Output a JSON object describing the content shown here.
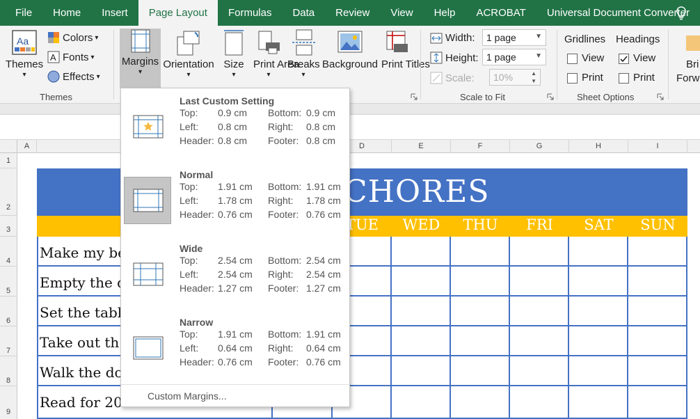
{
  "tabs": [
    {
      "label": "File"
    },
    {
      "label": "Home"
    },
    {
      "label": "Insert"
    },
    {
      "label": "Page Layout",
      "active": true
    },
    {
      "label": "Formulas"
    },
    {
      "label": "Data"
    },
    {
      "label": "Review"
    },
    {
      "label": "View"
    },
    {
      "label": "Help"
    },
    {
      "label": "ACROBAT"
    },
    {
      "label": "Universal Document Converter"
    }
  ],
  "ribbon": {
    "themes": {
      "themes_label": "Themes",
      "colors_label": "Colors",
      "fonts_label": "Fonts",
      "effects_label": "Effects",
      "group_label": "Themes"
    },
    "page_setup": {
      "margins_label": "Margins",
      "orientation_label": "Orientation",
      "size_label": "Size",
      "print_area_label": "Print Area",
      "breaks_label": "Breaks",
      "background_label": "Background",
      "print_titles_label": "Print Titles"
    },
    "scale": {
      "width_label": "Width:",
      "width_value": "1 page",
      "height_label": "Height:",
      "height_value": "1 page",
      "scale_label": "Scale:",
      "scale_value": "10%",
      "group_label": "Scale to Fit"
    },
    "sheet_options": {
      "gridlines_label": "Gridlines",
      "headings_label": "Headings",
      "view_label": "View",
      "print_label": "Print",
      "group_label": "Sheet Options",
      "gridlines_view": false,
      "gridlines_print": false,
      "headings_view": true,
      "headings_print": false
    },
    "arrange": {
      "bring_forward_label_1": "Bri",
      "bring_forward_label_2": "Forwa"
    }
  },
  "columns": [
    "A",
    "D",
    "E",
    "F",
    "G",
    "H",
    "I"
  ],
  "rows": [
    "1",
    "2",
    "3",
    "4",
    "5",
    "6",
    "7",
    "8",
    "9"
  ],
  "sheet": {
    "title": "CHORES",
    "days": [
      "TUE",
      "WED",
      "THU",
      "FRI",
      "SAT",
      "SUN"
    ],
    "chores": [
      "Make my be",
      "Empty the d",
      "Set the tabl",
      "Take out th",
      "Walk the do",
      "Read for 20"
    ]
  },
  "margins_menu": {
    "options": [
      {
        "name": "Last Custom Setting",
        "top_label": "Top:",
        "top": "0.9 cm",
        "bottom_label": "Bottom:",
        "bottom": "0.9 cm",
        "left_label": "Left:",
        "left": "0.8 cm",
        "right_label": "Right:",
        "right": "0.8 cm",
        "header_label": "Header:",
        "header": "0.8 cm",
        "footer_label": "Footer:",
        "footer": "0.8 cm"
      },
      {
        "name": "Normal",
        "top_label": "Top:",
        "top": "1.91 cm",
        "bottom_label": "Bottom:",
        "bottom": "1.91 cm",
        "left_label": "Left:",
        "left": "1.78 cm",
        "right_label": "Right:",
        "right": "1.78 cm",
        "header_label": "Header:",
        "header": "0.76 cm",
        "footer_label": "Footer:",
        "footer": "0.76 cm"
      },
      {
        "name": "Wide",
        "top_label": "Top:",
        "top": "2.54 cm",
        "bottom_label": "Bottom:",
        "bottom": "2.54 cm",
        "left_label": "Left:",
        "left": "2.54 cm",
        "right_label": "Right:",
        "right": "2.54 cm",
        "header_label": "Header:",
        "header": "1.27 cm",
        "footer_label": "Footer:",
        "footer": "1.27 cm"
      },
      {
        "name": "Narrow",
        "top_label": "Top:",
        "top": "1.91 cm",
        "bottom_label": "Bottom:",
        "bottom": "1.91 cm",
        "left_label": "Left:",
        "left": "0.64 cm",
        "right_label": "Right:",
        "right": "0.64 cm",
        "header_label": "Header:",
        "header": "0.76 cm",
        "footer_label": "Footer:",
        "footer": "0.76 cm"
      }
    ],
    "custom_margins_label": "Custom Margins..."
  },
  "colors": {
    "excel_green": "#217346",
    "title_blue": "#4472c4",
    "day_yellow": "#ffc000"
  }
}
